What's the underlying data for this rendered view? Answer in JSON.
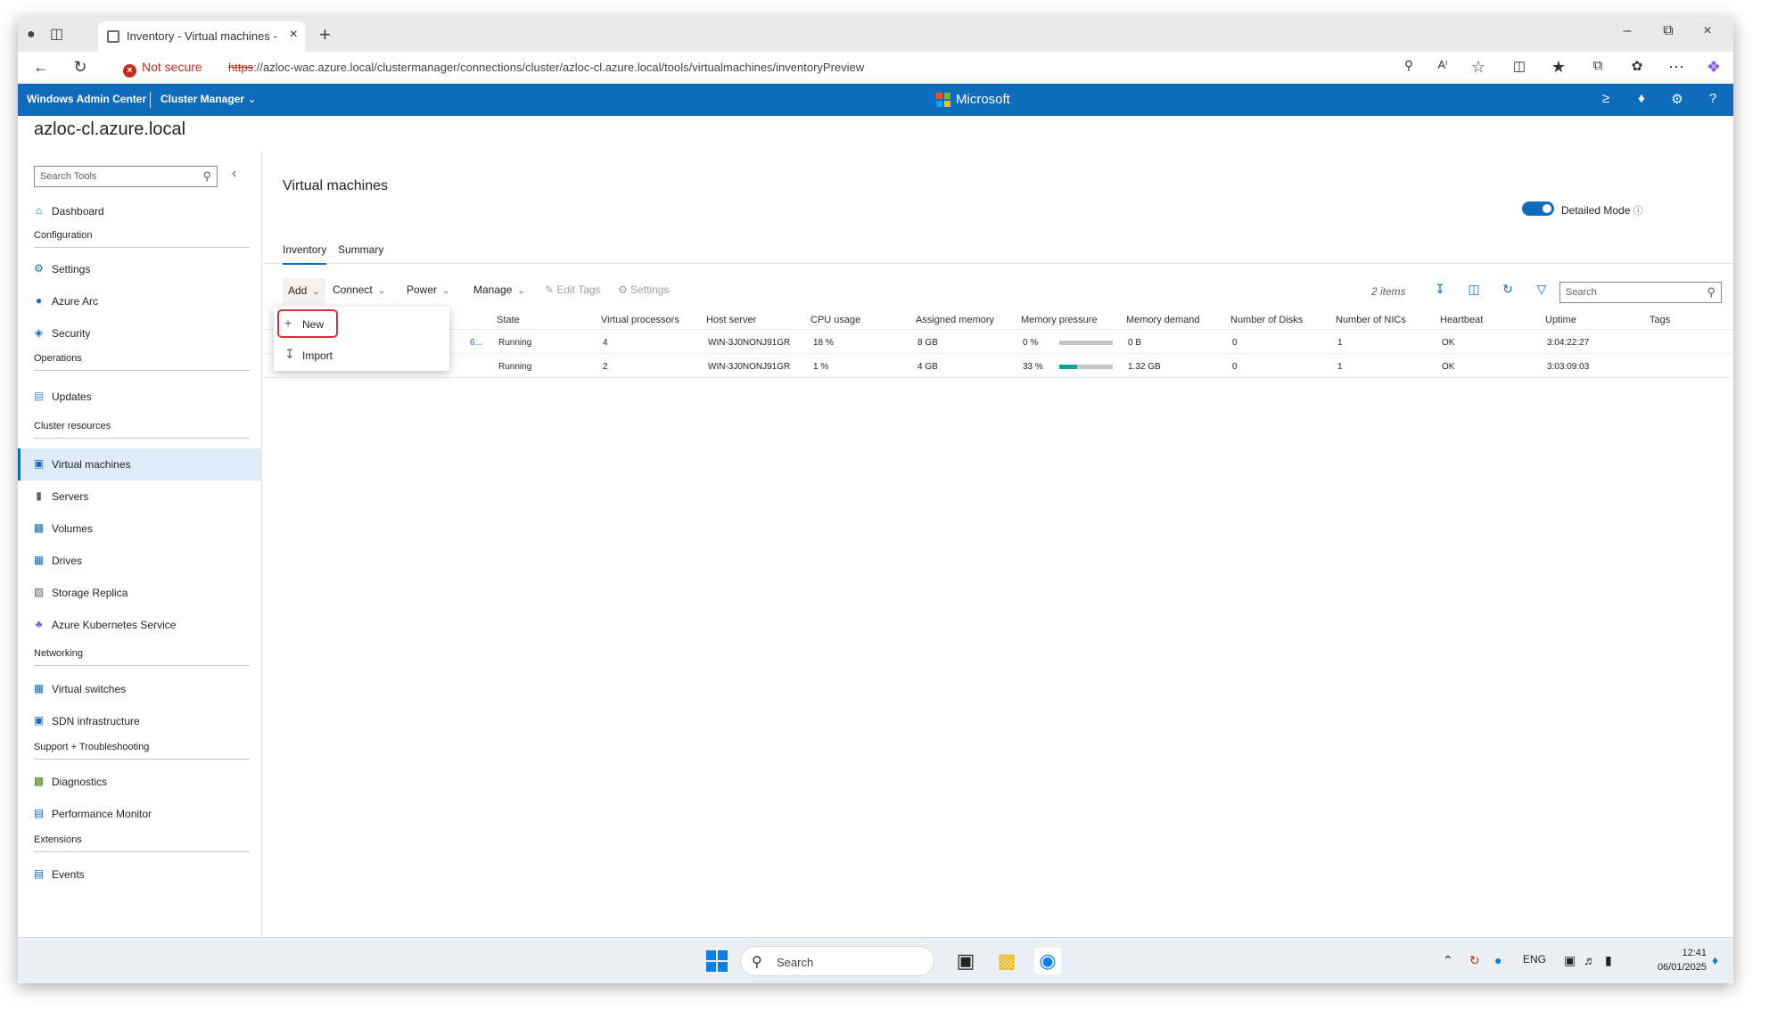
{
  "browser": {
    "tab_title": "Inventory - Virtual machines - Cluster Manager",
    "security_label": "Not secure",
    "url_protocol": "https",
    "url_rest": "://azloc-wac.azure.local/clustermanager/connections/cluster/azloc-cl.azure.local/tools/virtualmachines/inventoryPreview"
  },
  "header": {
    "product": "Windows Admin Center",
    "section": "Cluster Manager",
    "brand": "Microsoft"
  },
  "connection_name": "azloc-cl.azure.local",
  "sidebar": {
    "search_placeholder": "Search Tools",
    "dashboard": "Dashboard",
    "sections": {
      "configuration": "Configuration",
      "operations": "Operations",
      "cluster_resources": "Cluster resources",
      "networking": "Networking",
      "support": "Support + Troubleshooting",
      "extensions": "Extensions"
    },
    "items": {
      "settings": "Settings",
      "azure_arc": "Azure Arc",
      "security": "Security",
      "updates": "Updates",
      "virtual_machines": "Virtual machines",
      "servers": "Servers",
      "volumes": "Volumes",
      "drives": "Drives",
      "storage_replica": "Storage Replica",
      "aks": "Azure Kubernetes Service",
      "virtual_switches": "Virtual switches",
      "sdn": "SDN infrastructure",
      "diagnostics": "Diagnostics",
      "perfmon": "Performance Monitor",
      "events": "Events"
    }
  },
  "main": {
    "title": "Virtual machines",
    "detailed_mode": "Detailed Mode",
    "tabs": {
      "inventory": "Inventory",
      "summary": "Summary"
    },
    "toolbar": {
      "add": "Add",
      "connect": "Connect",
      "power": "Power",
      "manage": "Manage",
      "edit_tags": "Edit Tags",
      "settings": "Settings",
      "items_count": "2 items",
      "search_placeholder": "Search"
    },
    "add_menu": {
      "new": "New",
      "import": "Import"
    },
    "columns": {
      "state": "State",
      "vprocs": "Virtual processors",
      "host": "Host server",
      "cpu": "CPU usage",
      "mem": "Assigned memory",
      "pressure": "Memory pressure",
      "demand": "Memory demand",
      "disks": "Number of Disks",
      "nics": "Number of NICs",
      "heartbeat": "Heartbeat",
      "uptime": "Uptime",
      "tags": "Tags"
    },
    "rows": [
      {
        "name_tail": "6...",
        "state": "Running",
        "vprocs": "4",
        "host": "WIN-3J0NONJ91GR",
        "cpu": "18 %",
        "mem": "8 GB",
        "pressure": "0 %",
        "pressure_fraction": 0.0,
        "demand": "0 B",
        "disks": "0",
        "nics": "1",
        "heartbeat": "OK",
        "uptime": "3:04:22:27"
      },
      {
        "name_tail": "",
        "state": "Running",
        "vprocs": "2",
        "host": "WIN-3J0NONJ91GR",
        "cpu": "1 %",
        "mem": "4 GB",
        "pressure": "33 %",
        "pressure_fraction": 0.33,
        "demand": "1.32 GB",
        "disks": "0",
        "nics": "1",
        "heartbeat": "OK",
        "uptime": "3:03:09:03"
      }
    ]
  },
  "taskbar": {
    "search": "Search",
    "lang": "ENG",
    "time": "12:41",
    "date": "06/01/2025"
  }
}
